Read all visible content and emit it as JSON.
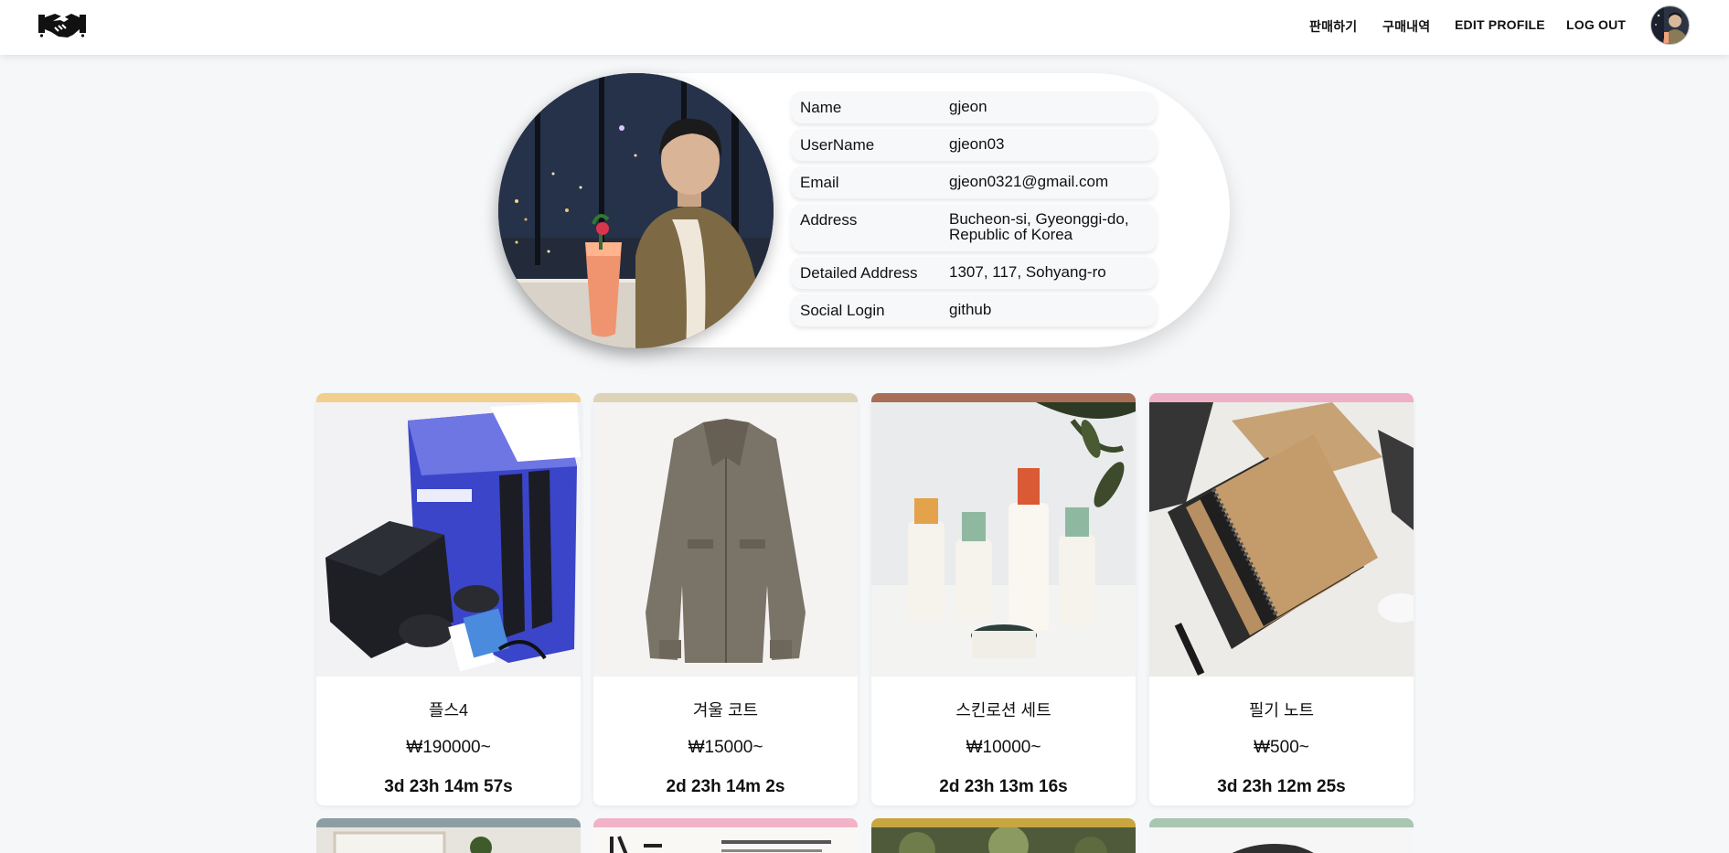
{
  "header": {
    "logo_icon": "handshake-icon",
    "nav": {
      "sell": "판매하기",
      "purchases": "구매내역",
      "edit_profile": "EDIT PROFILE",
      "logout": "LOG OUT"
    },
    "avatar_icon": "user-avatar"
  },
  "profile": {
    "photo_icon": "profile-photo",
    "fields": [
      {
        "label": "Name",
        "value": "gjeon"
      },
      {
        "label": "UserName",
        "value": "gjeon03"
      },
      {
        "label": "Email",
        "value": "gjeon0321@gmail.com"
      },
      {
        "label": "Address",
        "value": "Bucheon-si, Gyeonggi-do, Republic of Korea"
      },
      {
        "label": "Detailed Address",
        "value": "1307, 117, Sohyang-ro"
      },
      {
        "label": "Social Login",
        "value": "github"
      }
    ]
  },
  "products": [
    {
      "title": "플스4",
      "price": "₩190000~",
      "time_left": "3d 23h 14m 57s",
      "accent": "#f1cf8c",
      "image": "ps4-console-image"
    },
    {
      "title": "겨울 코트",
      "price": "₩15000~",
      "time_left": "2d 23h 14m 2s",
      "accent": "#ddd3b8",
      "image": "winter-coat-image"
    },
    {
      "title": "스킨로션 세트",
      "price": "₩10000~",
      "time_left": "2d 23h 13m 16s",
      "accent": "#a86e58",
      "image": "skin-lotion-set-image"
    },
    {
      "title": "필기 노트",
      "price": "₩500~",
      "time_left": "3d 23h 12m 25s",
      "accent": "#eeb0c4",
      "image": "notebooks-image"
    }
  ],
  "more_products": [
    {
      "accent": "#8c9ea4",
      "image": "room-image"
    },
    {
      "accent": "#f2b3c8",
      "image": "book-page-image"
    },
    {
      "accent": "#c9a640",
      "image": "garden-image"
    },
    {
      "accent": "#a8c6b0",
      "image": "round-object-image"
    }
  ],
  "colors": {
    "page_background": "#f5f7f9",
    "header_background": "#ffffff",
    "card_background": "#ffffff"
  }
}
